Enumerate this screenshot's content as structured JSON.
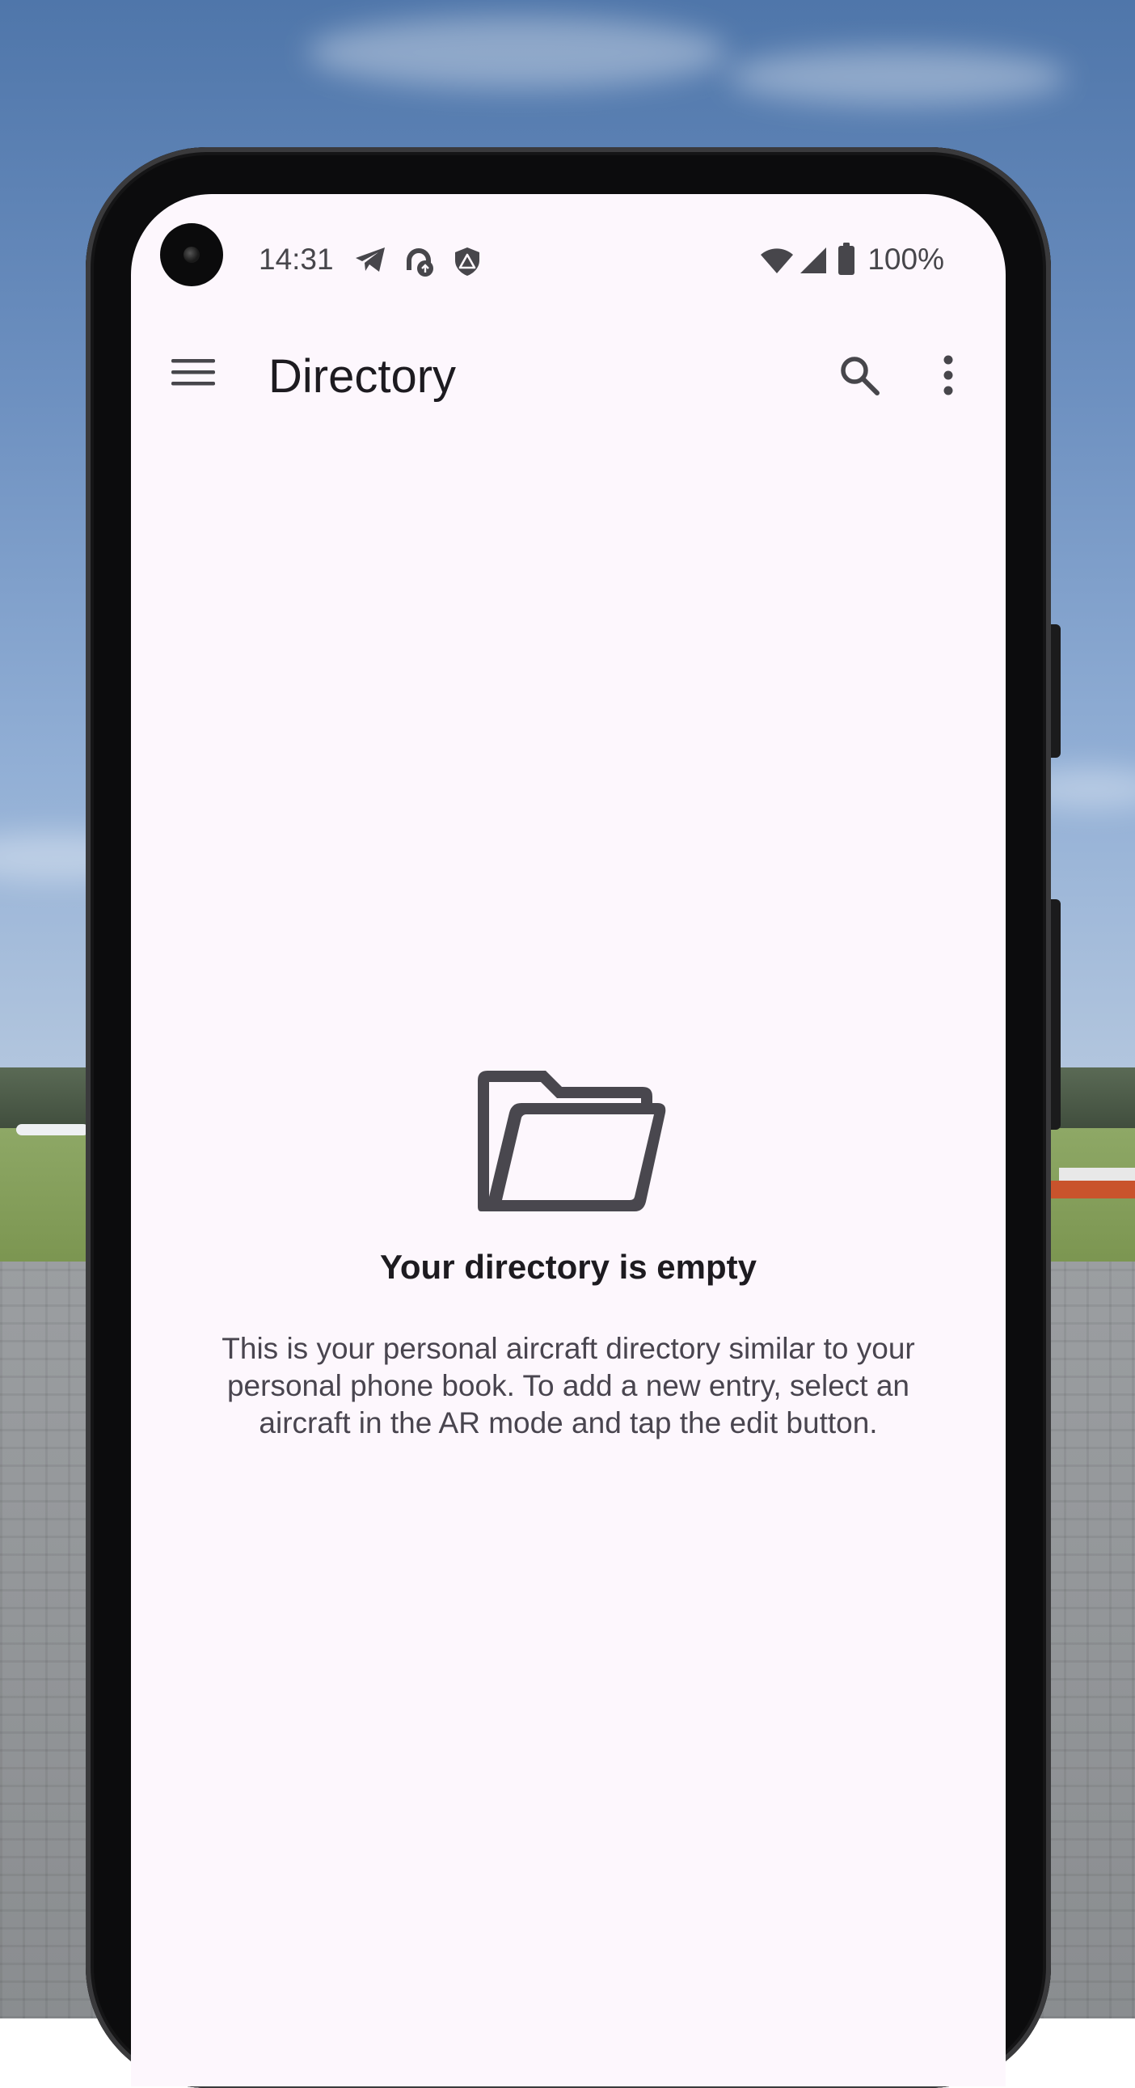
{
  "status_bar": {
    "time": "14:31",
    "battery": "100%",
    "notification_icons": [
      "telegram-icon",
      "sync-icon",
      "alert-shield-icon"
    ],
    "system_icons": [
      "wifi-icon",
      "signal-icon",
      "battery-icon"
    ]
  },
  "app_bar": {
    "title": "Directory",
    "menu_icon": "menu-icon",
    "actions": [
      "search-icon",
      "more-vert-icon"
    ]
  },
  "empty_state": {
    "icon": "folder-open-icon",
    "title": "Your directory is empty",
    "message": "This is your personal aircraft directory similar to your personal phone book. To add a new entry, select an aircraft in the AR mode and tap the edit button."
  },
  "colors": {
    "screen_background": "#fdf7fd",
    "text_primary": "#1d1b20",
    "text_secondary": "#49454f",
    "icon": "#47464b"
  }
}
